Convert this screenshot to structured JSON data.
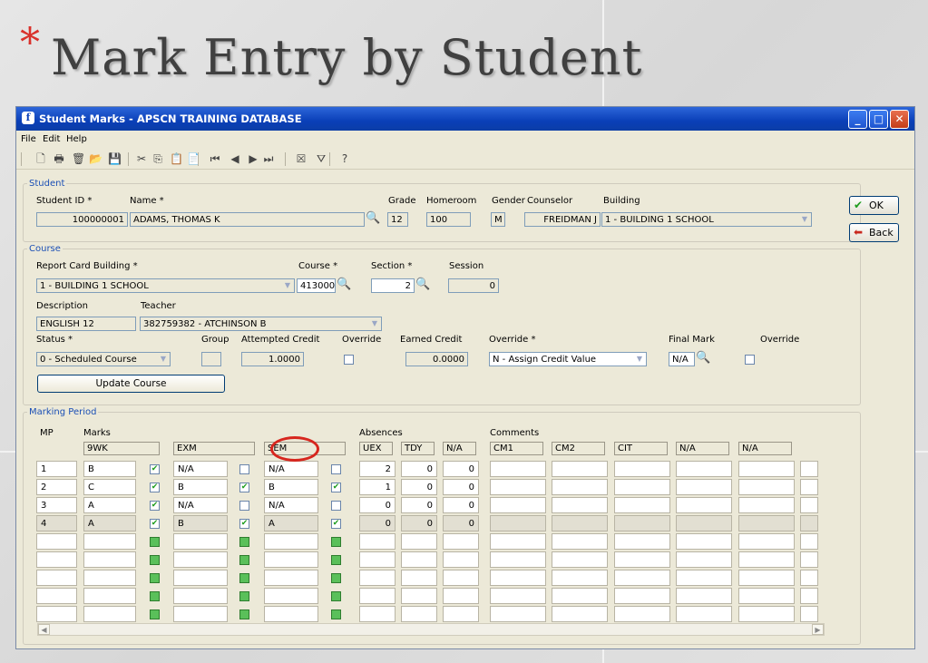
{
  "slide": {
    "title": "Mark Entry by Student",
    "bullet": "*"
  },
  "window": {
    "title": "Student Marks - APSCN TRAINING DATABASE"
  },
  "menu": [
    "File",
    "Edit",
    "Help"
  ],
  "toolbar_icons": [
    "new-icon",
    "print-icon",
    "delete-icon",
    "open-icon",
    "save-icon",
    "cut-icon",
    "copy-icon",
    "paste-icon",
    "clipboard-icon",
    "first-record-icon",
    "previous-record-icon",
    "next-record-icon",
    "last-record-icon",
    "close-record-icon",
    "filter-icon",
    "help-icon"
  ],
  "student": {
    "legend": "Student",
    "id_label": "Student ID *",
    "id_value": "100000001",
    "name_label": "Name *",
    "name_value": "ADAMS, THOMAS K",
    "grade_label": "Grade",
    "grade_value": "12",
    "homeroom_label": "Homeroom",
    "homeroom_value": "100",
    "gender_label": "Gender",
    "gender_value": "M",
    "counselor_label": "Counselor",
    "counselor_value": "FREIDMAN J",
    "building_label": "Building",
    "building_value": "1 - BUILDING 1 SCHOOL"
  },
  "course": {
    "legend": "Course",
    "rcb_label": "Report Card Building *",
    "rcb_value": "1 - BUILDING 1 SCHOOL",
    "course_label": "Course *",
    "course_value": "413000",
    "section_label": "Section *",
    "section_value": "2",
    "session_label": "Session",
    "session_value": "0",
    "desc_label": "Description",
    "desc_value": "ENGLISH 12",
    "teacher_label": "Teacher",
    "teacher_value": "382759382 - ATCHINSON B",
    "status_label": "Status *",
    "status_value": "0 - Scheduled Course",
    "group_label": "Group",
    "attempted_label": "Attempted Credit",
    "attempted_value": "1.0000",
    "override_label": "Override",
    "earned_label": "Earned Credit",
    "earned_value": "0.0000",
    "override2_label": "Override *",
    "override2_value": "N - Assign Credit Value",
    "final_label": "Final Mark",
    "final_value": "N/A",
    "override3_label": "Override",
    "update_button": "Update Course"
  },
  "side_buttons": {
    "ok": "OK",
    "back": "Back"
  },
  "marking": {
    "legend": "Marking Period",
    "mp_label": "MP",
    "marks_label": "Marks",
    "absences_label": "Absences",
    "comments_label": "Comments",
    "mark_headers": [
      "9WK",
      "EXM",
      "SEM"
    ],
    "absence_headers": [
      "UEX",
      "TDY",
      "N/A"
    ],
    "comment_headers": [
      "CM1",
      "CM2",
      "CIT",
      "N/A",
      "N/A"
    ],
    "rows": [
      {
        "mp": "1",
        "m1": "B",
        "c1": true,
        "m2": "N/A",
        "c2": false,
        "m3": "N/A",
        "c3": false,
        "uex": "2",
        "tdy": "0",
        "na": "0"
      },
      {
        "mp": "2",
        "m1": "C",
        "c1": true,
        "m2": "B",
        "c2": true,
        "m3": "B",
        "c3": true,
        "uex": "1",
        "tdy": "0",
        "na": "0"
      },
      {
        "mp": "3",
        "m1": "A",
        "c1": true,
        "m2": "N/A",
        "c2": false,
        "m3": "N/A",
        "c3": false,
        "uex": "0",
        "tdy": "0",
        "na": "0"
      },
      {
        "mp": "4",
        "m1": "A",
        "c1": true,
        "m2": "B",
        "c2": true,
        "m3": "A",
        "c3": true,
        "uex": "0",
        "tdy": "0",
        "na": "0"
      }
    ],
    "empty_rows": 5,
    "highlight": "SEM"
  }
}
